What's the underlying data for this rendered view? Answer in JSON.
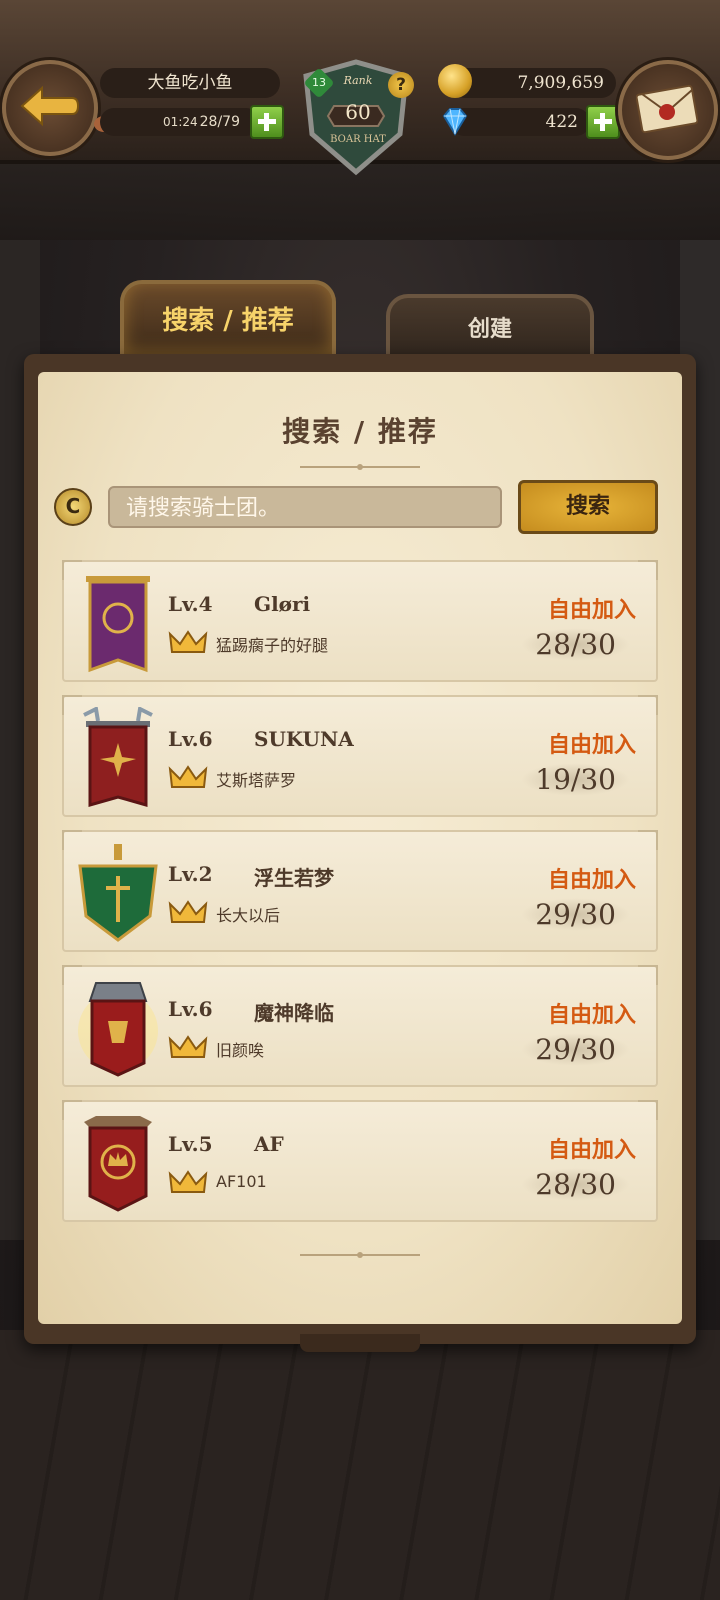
{
  "player": {
    "name": "大鱼吃小鱼",
    "stamina_time": "01:24",
    "stamina": "28/79",
    "level": "13",
    "rank_label": "Rank",
    "rank": "60",
    "rank_sub": "BOAR HAT",
    "gold": "7,909,659",
    "gems": "422"
  },
  "tabs": [
    {
      "label": "搜索 / 推荐",
      "active": true
    },
    {
      "label": "创建",
      "active": false
    }
  ],
  "panel": {
    "title": "搜索 / 推荐",
    "search_placeholder": "请搜索骑士团。",
    "search_button": "搜索"
  },
  "guilds": [
    {
      "level": "Lv.4",
      "name": "Gløri",
      "leader": "猛踢瘸子的好腿",
      "join": "自由加入",
      "members": "28/30",
      "color": "#6b2a6e"
    },
    {
      "level": "Lv.6",
      "name": "SUKUNA",
      "leader": "艾斯塔萨罗",
      "join": "自由加入",
      "members": "19/30",
      "color": "#8e1f1f"
    },
    {
      "level": "Lv.2",
      "name": "浮生若梦",
      "leader": "长大以后",
      "join": "自由加入",
      "members": "29/30",
      "color": "#1e6b3a"
    },
    {
      "level": "Lv.6",
      "name": "魔神降临",
      "leader": "旧颜唉",
      "join": "自由加入",
      "members": "29/30",
      "color": "#9a1c1c"
    },
    {
      "level": "Lv.5",
      "name": "AF",
      "leader": "AF101",
      "join": "自由加入",
      "members": "28/30",
      "color": "#961d1d"
    }
  ],
  "colors": {
    "join": "#d45a12",
    "accent": "#f7d36a",
    "parchment": "#f6ecd4"
  },
  "icons": {
    "back": "back-arrow-icon",
    "mail": "mail-icon",
    "gold": "gold-coin-icon",
    "gem": "diamond-icon",
    "refresh": "refresh-icon",
    "crown": "crown-icon"
  }
}
